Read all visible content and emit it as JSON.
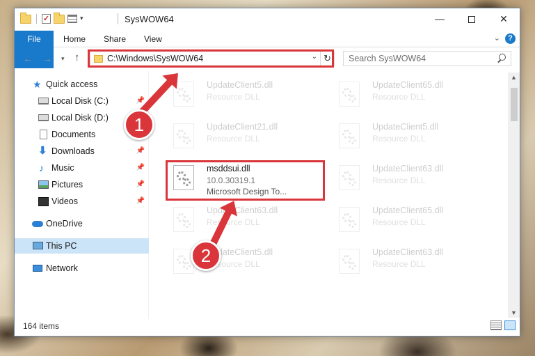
{
  "window": {
    "title": "SysWOW64",
    "min_glyph": "—",
    "close_glyph": "✕"
  },
  "ribbon": {
    "tabs": [
      "File",
      "Home",
      "Share",
      "View"
    ],
    "help": "?"
  },
  "address_bar": {
    "path": "C:\\Windows\\SysWOW64",
    "refresh_glyph": "↻"
  },
  "search": {
    "placeholder": "Search SysWOW64"
  },
  "sidebar": {
    "items": [
      {
        "label": "Quick access",
        "icon": "star-icon",
        "pinned": false
      },
      {
        "label": "Local Disk (C:)",
        "icon": "drive-icon",
        "pinned": true
      },
      {
        "label": "Local Disk (D:)",
        "icon": "drive-icon",
        "pinned": false
      },
      {
        "label": "Documents",
        "icon": "documents-icon",
        "pinned": true
      },
      {
        "label": "Downloads",
        "icon": "downloads-icon",
        "pinned": true
      },
      {
        "label": "Music",
        "icon": "music-icon",
        "pinned": true
      },
      {
        "label": "Pictures",
        "icon": "pictures-icon",
        "pinned": true
      },
      {
        "label": "Videos",
        "icon": "videos-icon",
        "pinned": true
      },
      {
        "label": "OneDrive",
        "icon": "onedrive-icon",
        "pinned": false
      },
      {
        "label": "This PC",
        "icon": "this-pc-icon",
        "pinned": false,
        "selected": true
      },
      {
        "label": "Network",
        "icon": "network-icon",
        "pinned": false
      }
    ]
  },
  "files": [
    {
      "name": "UpdateClient5.dll",
      "line2": "Resource DLL",
      "line3": ""
    },
    {
      "name": "UpdateClient65.dll",
      "line2": "Resource DLL",
      "line3": ""
    },
    {
      "name": "UpdateClient21.dll",
      "line2": "Resource DLL",
      "line3": ""
    },
    {
      "name": "UpdateClient5.dll",
      "line2": "Resource DLL",
      "line3": ""
    },
    {
      "name": "msddsui.dll",
      "line2": "10.0.30319.1",
      "line3": "Microsoft Design To..."
    },
    {
      "name": "UpdateClient63.dll",
      "line2": "Resource DLL",
      "line3": ""
    },
    {
      "name": "UpdateClient63.dll",
      "line2": "Resource DLL",
      "line3": ""
    },
    {
      "name": "UpdateClient65.dll",
      "line2": "Resource DLL",
      "line3": ""
    },
    {
      "name": "UpdateClient5.dll",
      "line2": "Resource DLL",
      "line3": ""
    },
    {
      "name": "UpdateClient63.dll",
      "line2": "Resource DLL",
      "line3": ""
    }
  ],
  "status": {
    "item_count": "164 items"
  },
  "annotations": {
    "step1": "1",
    "step2": "2",
    "color": "#d9353b"
  },
  "colors": {
    "accent": "#1979ca",
    "selection": "#cce4f7"
  }
}
